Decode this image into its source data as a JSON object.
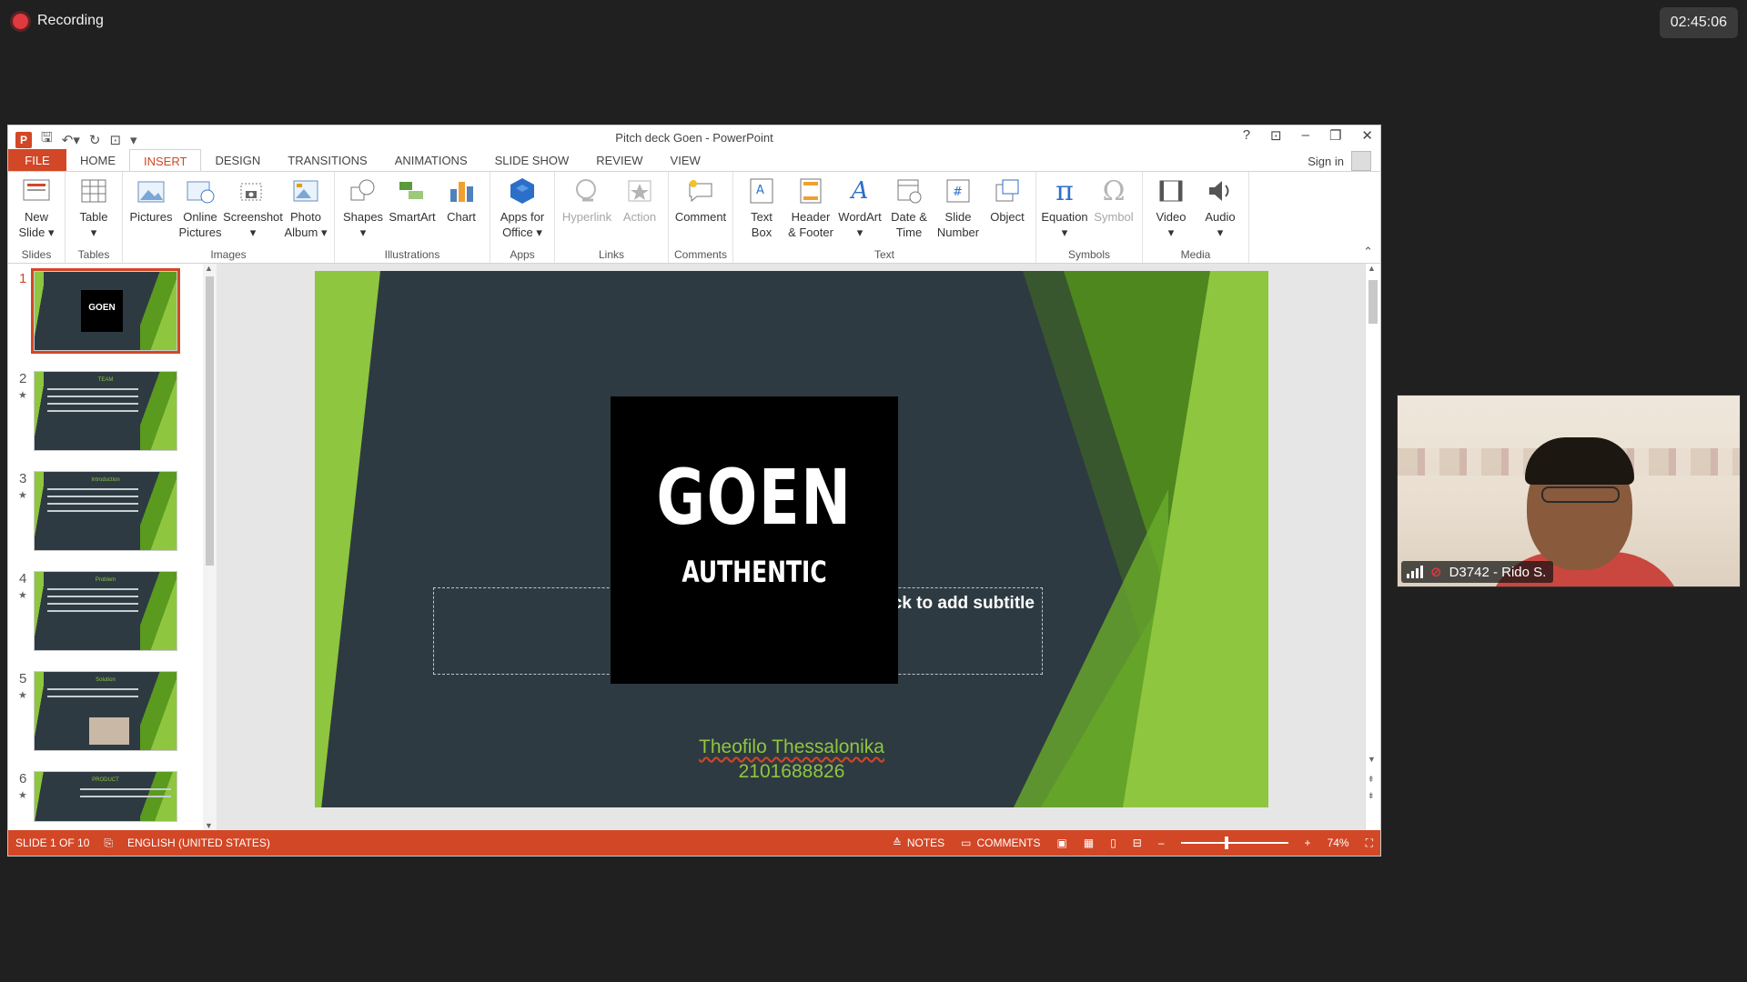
{
  "meeting": {
    "recording_label": "Recording",
    "clock": "02:45:06",
    "participant_name": "D3742 - Rido S.",
    "recording_color": "#e0393e"
  },
  "window": {
    "title": "Pitch deck Goen - PowerPoint",
    "sign_in": "Sign in",
    "app_icon": "P"
  },
  "tabs": [
    "FILE",
    "HOME",
    "INSERT",
    "DESIGN",
    "TRANSITIONS",
    "ANIMATIONS",
    "SLIDE SHOW",
    "REVIEW",
    "VIEW"
  ],
  "active_tab": "INSERT",
  "ribbon": {
    "groups": [
      {
        "label": "Slides",
        "buttons": [
          {
            "line1": "New",
            "line2": "Slide ▾",
            "icon": "new-slide-icon"
          }
        ]
      },
      {
        "label": "Tables",
        "buttons": [
          {
            "line1": "Table",
            "line2": "▾",
            "icon": "table-icon"
          }
        ]
      },
      {
        "label": "Images",
        "buttons": [
          {
            "line1": "Pictures",
            "line2": "",
            "icon": "pictures-icon"
          },
          {
            "line1": "Online",
            "line2": "Pictures",
            "icon": "online-pictures-icon"
          },
          {
            "line1": "Screenshot",
            "line2": "▾",
            "icon": "screenshot-icon"
          },
          {
            "line1": "Photo",
            "line2": "Album ▾",
            "icon": "photo-album-icon"
          }
        ]
      },
      {
        "label": "Illustrations",
        "buttons": [
          {
            "line1": "Shapes",
            "line2": "▾",
            "icon": "shapes-icon"
          },
          {
            "line1": "SmartArt",
            "line2": "",
            "icon": "smartart-icon"
          },
          {
            "line1": "Chart",
            "line2": "",
            "icon": "chart-icon"
          }
        ]
      },
      {
        "label": "Apps",
        "buttons": [
          {
            "line1": "Apps for",
            "line2": "Office ▾",
            "icon": "apps-for-office-icon"
          }
        ]
      },
      {
        "label": "Links",
        "buttons": [
          {
            "line1": "Hyperlink",
            "line2": "",
            "icon": "hyperlink-icon",
            "disabled": true
          },
          {
            "line1": "Action",
            "line2": "",
            "icon": "action-icon",
            "disabled": true
          }
        ]
      },
      {
        "label": "Comments",
        "buttons": [
          {
            "line1": "Comment",
            "line2": "",
            "icon": "comment-icon"
          }
        ]
      },
      {
        "label": "Text",
        "buttons": [
          {
            "line1": "Text",
            "line2": "Box",
            "icon": "text-box-icon"
          },
          {
            "line1": "Header",
            "line2": "& Footer",
            "icon": "header-footer-icon"
          },
          {
            "line1": "WordArt",
            "line2": "▾",
            "icon": "wordart-icon"
          },
          {
            "line1": "Date &",
            "line2": "Time",
            "icon": "date-time-icon"
          },
          {
            "line1": "Slide",
            "line2": "Number",
            "icon": "slide-number-icon"
          },
          {
            "line1": "Object",
            "line2": "",
            "icon": "object-icon"
          }
        ]
      },
      {
        "label": "Symbols",
        "buttons": [
          {
            "line1": "Equation",
            "line2": "▾",
            "icon": "equation-icon"
          },
          {
            "line1": "Symbol",
            "line2": "",
            "icon": "symbol-icon",
            "disabled": true
          }
        ]
      },
      {
        "label": "Media",
        "buttons": [
          {
            "line1": "Video",
            "line2": "▾",
            "icon": "video-icon"
          },
          {
            "line1": "Audio",
            "line2": "▾",
            "icon": "audio-icon"
          }
        ]
      }
    ]
  },
  "thumbnails": [
    {
      "num": "1",
      "title": "",
      "logo": "GOEN",
      "active": true,
      "star": false
    },
    {
      "num": "2",
      "title": "TEAM",
      "star": true
    },
    {
      "num": "3",
      "title": "Introduction",
      "star": true
    },
    {
      "num": "4",
      "title": "Problem",
      "star": true
    },
    {
      "num": "5",
      "title": "Solution",
      "star": true,
      "picture": true
    },
    {
      "num": "6",
      "title": "PRODUCT",
      "star": true
    }
  ],
  "slide": {
    "logo_main": "GOEN",
    "logo_sub": "AUTHENTIC",
    "subtitle_placeholder": "ck to add subtitle",
    "author_name": "Theofilo Thessalonika",
    "author_id": "2101688826",
    "accent": "#8ec63f",
    "background": "#2e3a41"
  },
  "status": {
    "slide_info": "SLIDE 1 OF 10",
    "language": "ENGLISH (UNITED STATES)",
    "notes": "NOTES",
    "comments": "COMMENTS",
    "zoom": "74%",
    "bar_color": "#d24726"
  }
}
